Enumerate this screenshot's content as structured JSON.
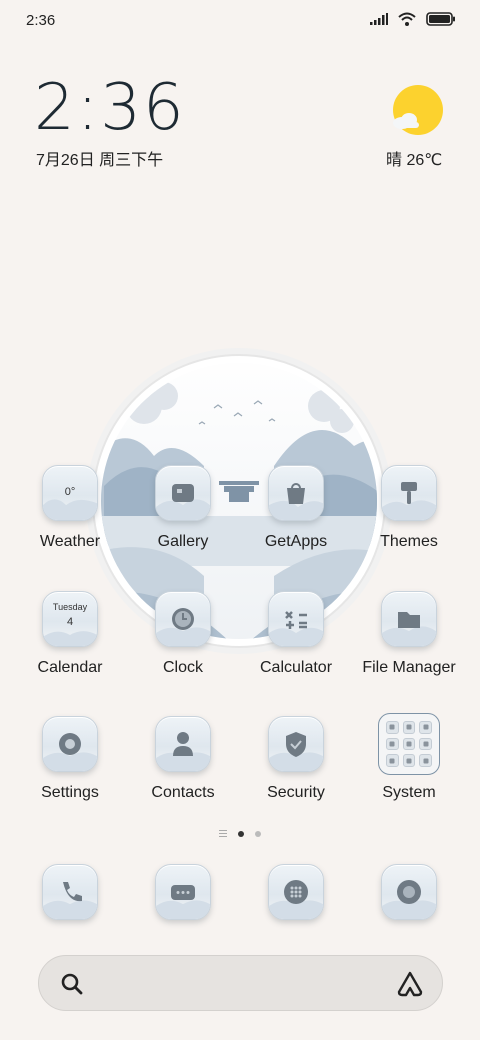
{
  "status_bar": {
    "time": "2:36"
  },
  "clock": {
    "time": "2:36",
    "date": "7月26日 周三下午"
  },
  "weather": {
    "condition": "晴",
    "temperature": "26℃",
    "label": "晴 26℃"
  },
  "apps": [
    {
      "label": "Weather",
      "icon": "weather-icon",
      "detail": "0°"
    },
    {
      "label": "Gallery",
      "icon": "gallery-icon"
    },
    {
      "label": "GetApps",
      "icon": "getapps-icon"
    },
    {
      "label": "Themes",
      "icon": "themes-icon"
    },
    {
      "label": "Calendar",
      "icon": "calendar-icon",
      "day": "Tuesday",
      "num": "4"
    },
    {
      "label": "Clock",
      "icon": "clock-icon"
    },
    {
      "label": "Calculator",
      "icon": "calculator-icon"
    },
    {
      "label": "File Manager",
      "icon": "folder-icon"
    },
    {
      "label": "Settings",
      "icon": "settings-icon"
    },
    {
      "label": "Contacts",
      "icon": "contacts-icon"
    },
    {
      "label": "Security",
      "icon": "shield-icon"
    },
    {
      "label": "System",
      "icon": "folder-grid-icon"
    }
  ],
  "dock": [
    "phone-icon",
    "messages-icon",
    "browser-icon",
    "camera-icon"
  ],
  "page_indicator": {
    "pages": 2,
    "active": 1
  },
  "colors": {
    "background": "#f7f3f0",
    "sun": "#fcd22e",
    "accent_border": "#7e93a6"
  }
}
